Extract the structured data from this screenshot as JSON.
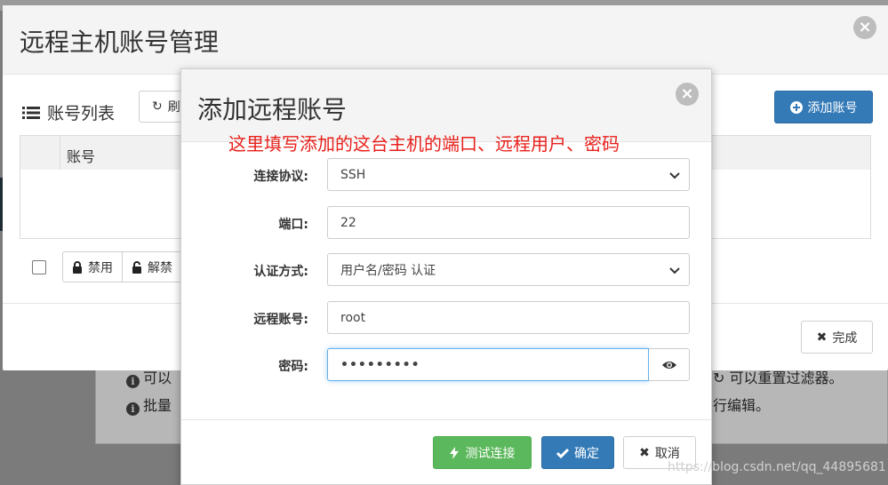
{
  "background": {
    "hint1_prefix": "可以",
    "hint1_suffix": "可以重置过滤器。",
    "hint2_prefix": "批量",
    "hint2_suffix": "行编辑。"
  },
  "outer_modal": {
    "title": "远程主机账号管理",
    "toolbar": {
      "list_title": "账号列表",
      "refresh_label": "刷",
      "add_account_label": "添加账号"
    },
    "table": {
      "columns": [
        "账号"
      ]
    },
    "batch": {
      "disable_label": "禁用",
      "enable_label": "解禁"
    },
    "footer": {
      "done_label": "完成"
    }
  },
  "inner_modal": {
    "title": "添加远程账号",
    "annotation": "这里填写添加的这台主机的端口、远程用户、密码",
    "form": {
      "protocol": {
        "label": "连接协议:",
        "value": "SSH"
      },
      "port": {
        "label": "端口:",
        "value": "22"
      },
      "auth": {
        "label": "认证方式:",
        "value": "用户名/密码 认证"
      },
      "account": {
        "label": "远程账号:",
        "value": "root"
      },
      "password": {
        "label": "密码:",
        "value": "•••••••••"
      }
    },
    "footer": {
      "test_label": "测试连接",
      "confirm_label": "确定",
      "cancel_label": "取消"
    }
  },
  "watermark": "https://blog.csdn.net/qq_44895681",
  "colors": {
    "primary": "#337ab7",
    "success": "#5cb85c",
    "annotation": "#e8201b"
  }
}
